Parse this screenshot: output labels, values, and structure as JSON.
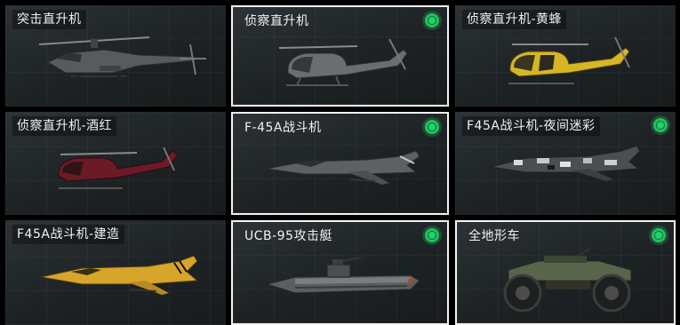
{
  "vehicles": [
    {
      "label": "突击直升机",
      "equipped": false,
      "icon": "attack-helicopter-icon"
    },
    {
      "label": "侦察直升机",
      "equipped": true,
      "icon": "scout-helicopter-icon"
    },
    {
      "label": "侦察直升机-黄蜂",
      "equipped": false,
      "icon": "scout-helicopter-yellow-icon"
    },
    {
      "label": "侦察直升机-酒红",
      "equipped": false,
      "icon": "scout-helicopter-wine-icon"
    },
    {
      "label": "F-45A战斗机",
      "equipped": true,
      "icon": "fighter-jet-icon"
    },
    {
      "label": "F45A战斗机-夜间迷彩",
      "equipped": true,
      "icon": "fighter-jet-camo-icon"
    },
    {
      "label": "F45A战斗机-建造",
      "equipped": false,
      "icon": "fighter-jet-yellow-icon"
    },
    {
      "label": "UCB-95攻击艇",
      "equipped": true,
      "icon": "attack-boat-icon"
    },
    {
      "label": "全地形车",
      "equipped": true,
      "icon": "atv-icon"
    }
  ],
  "colors": {
    "equipped_indicator": "#23c15e",
    "yellow_livery": "#d6b625",
    "wine_livery": "#6b1a26",
    "gray_livery": "#5d6164"
  }
}
